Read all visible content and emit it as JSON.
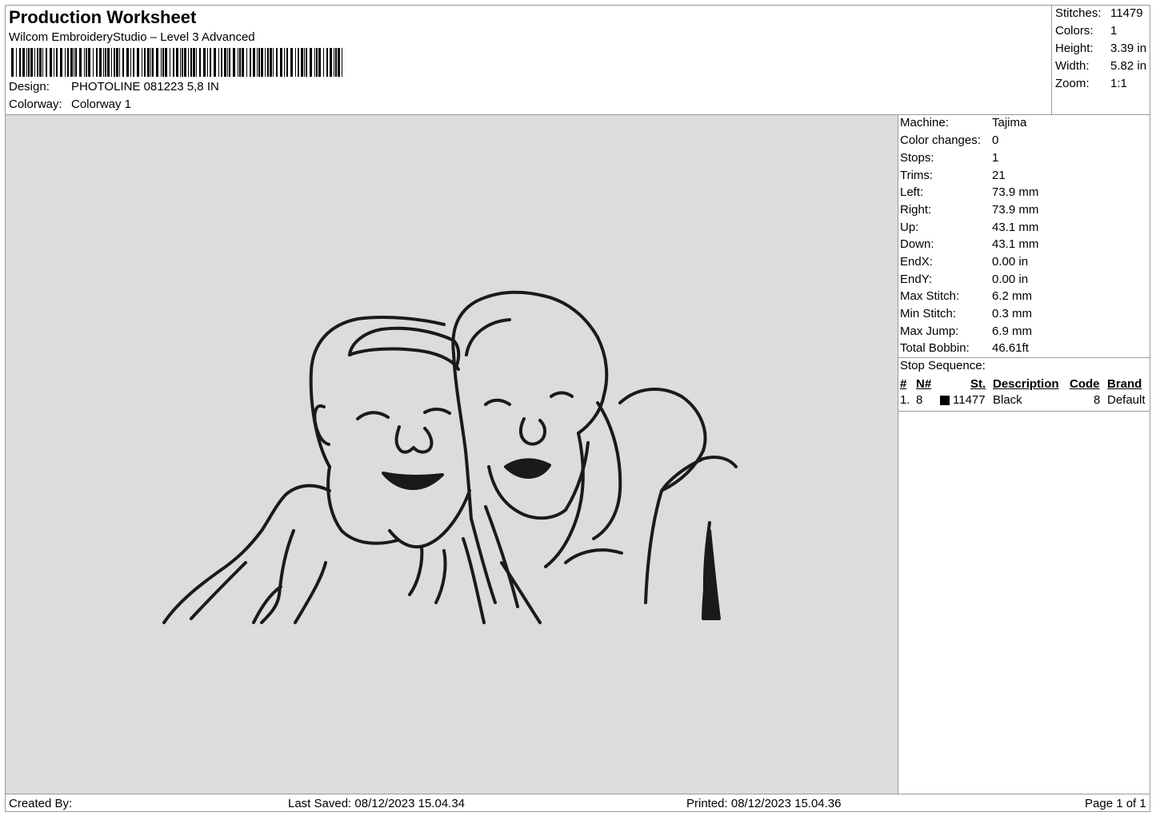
{
  "header": {
    "title": "Production Worksheet",
    "subtitle": "Wilcom EmbroideryStudio – Level 3 Advanced",
    "design_label": "Design:",
    "design_value": "PHOTOLINE 081223 5,8 IN",
    "colorway_label": "Colorway:",
    "colorway_value": "Colorway 1"
  },
  "stats": [
    {
      "label": "Stitches:",
      "value": "11479"
    },
    {
      "label": "Colors:",
      "value": "1"
    },
    {
      "label": "Height:",
      "value": "3.39 in"
    },
    {
      "label": "Width:",
      "value": "5.82 in"
    },
    {
      "label": "Zoom:",
      "value": "1:1"
    }
  ],
  "info": [
    {
      "label": "Machine:",
      "value": "Tajima"
    },
    {
      "label": "Color changes:",
      "value": "0"
    },
    {
      "label": "Stops:",
      "value": "1"
    },
    {
      "label": "Trims:",
      "value": "21"
    },
    {
      "label": "Left:",
      "value": "73.9 mm"
    },
    {
      "label": "Right:",
      "value": "73.9 mm"
    },
    {
      "label": "Up:",
      "value": "43.1 mm"
    },
    {
      "label": "Down:",
      "value": "43.1 mm"
    },
    {
      "label": "EndX:",
      "value": "0.00 in"
    },
    {
      "label": "EndY:",
      "value": "0.00 in"
    },
    {
      "label": "Max Stitch:",
      "value": "6.2 mm"
    },
    {
      "label": "Min Stitch:",
      "value": "0.3 mm"
    },
    {
      "label": "Max Jump:",
      "value": "6.9 mm"
    },
    {
      "label": "Total Bobbin:",
      "value": "46.61ft"
    }
  ],
  "stop_sequence": {
    "label": "Stop Sequence:",
    "headers": {
      "num": "#",
      "n": "N#",
      "st": "St.",
      "description": "Description",
      "code": "Code",
      "brand": "Brand"
    },
    "rows": [
      {
        "num": "1.",
        "n": "8",
        "swatch_color": "#000000",
        "st": "11477",
        "description": "Black",
        "code": "8",
        "brand": "Default"
      }
    ]
  },
  "footer": {
    "created_by": "Created By:",
    "last_saved": "Last Saved: 08/12/2023 15.04.34",
    "printed": "Printed: 08/12/2023 15.04.36",
    "page": "Page 1 of 1"
  },
  "colors": {
    "design_background": "#dcdcdc",
    "thread": "#1a1a1a"
  }
}
